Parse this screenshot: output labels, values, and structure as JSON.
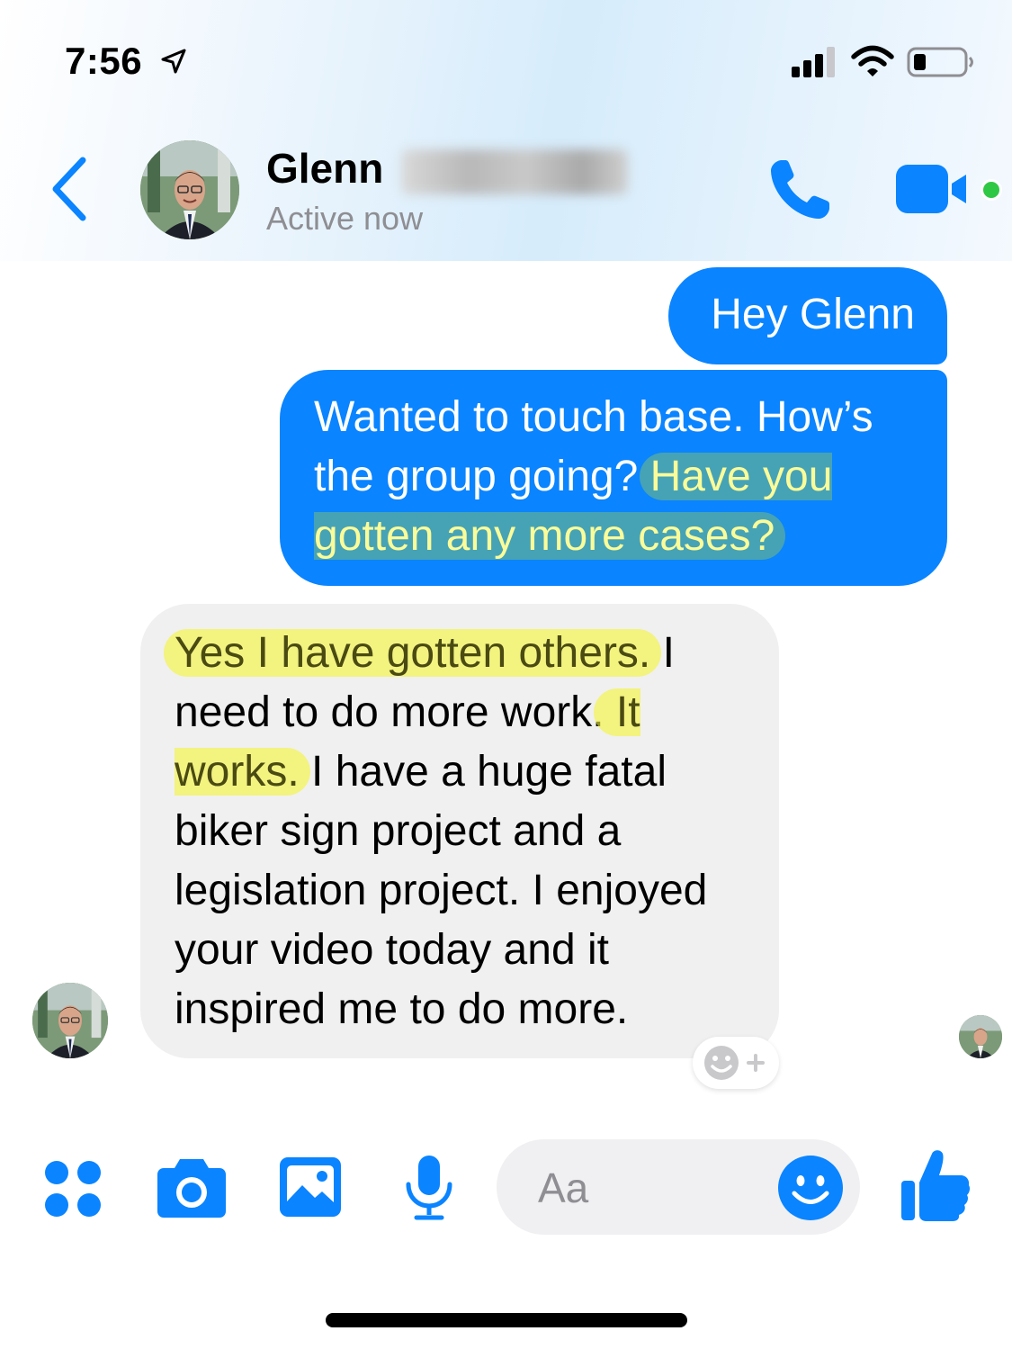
{
  "status_bar": {
    "time": "7:56"
  },
  "header": {
    "contact_first_name": "Glenn",
    "status": "Active now"
  },
  "messages": [
    {
      "direction": "outgoing",
      "text": "Hey Glenn"
    },
    {
      "direction": "outgoing",
      "segments": [
        {
          "text": "Wanted to touch base. How’s the group going? ",
          "highlight": "none"
        },
        {
          "text": "Have you gotten any more cases?",
          "highlight": "green"
        }
      ]
    },
    {
      "direction": "incoming",
      "segments": [
        {
          "text": "Yes I have gotten others.",
          "highlight": "yellow"
        },
        {
          "text": " I need to do more work.",
          "highlight": "none"
        },
        {
          "text": " It works.",
          "highlight": "yellow"
        },
        {
          "text": " I have a huge fatal biker sign project and a legislation project. I enjoyed your video today and it inspired me to do more.",
          "highlight": "none"
        }
      ]
    }
  ],
  "composer": {
    "placeholder": "Aa"
  },
  "icons": {
    "back": "chevron-left-icon",
    "call": "phone-icon",
    "video": "video-camera-icon",
    "apps": "four-dots-icon",
    "camera": "camera-icon",
    "gallery": "image-icon",
    "mic": "microphone-icon",
    "emoji": "smiley-icon",
    "like": "thumbs-up-icon",
    "react": "add-reaction-icon"
  },
  "colors": {
    "accent": "#0a84ff",
    "outgoing_bubble": "#0a84ff",
    "incoming_bubble": "#f0f0f0",
    "online": "#2fc845",
    "highlight_yellow": "#f5f53c",
    "highlight_green": "#78be78"
  }
}
